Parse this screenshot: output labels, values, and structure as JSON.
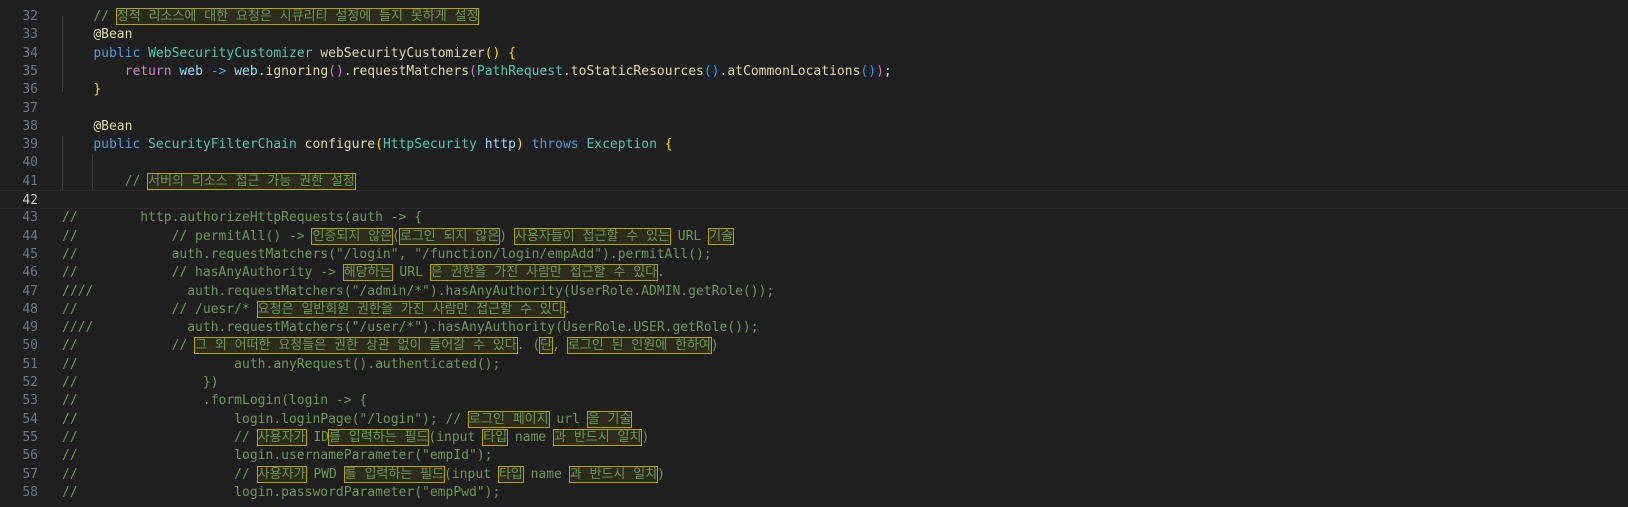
{
  "editor": {
    "current_line": 42,
    "lines": [
      {
        "num": "32",
        "segments": [
          {
            "t": "    "
          },
          {
            "t": "// ",
            "c": "cm"
          },
          {
            "t": "정적 리소스에 대한 요청은 시큐리티 설정에 들지 못하게 설정",
            "c": "cm",
            "h": true
          }
        ]
      },
      {
        "num": "33",
        "segments": [
          {
            "t": "    "
          },
          {
            "t": "@Bean",
            "c": "ann"
          }
        ]
      },
      {
        "num": "34",
        "segments": [
          {
            "t": "    "
          },
          {
            "t": "public ",
            "c": "kw"
          },
          {
            "t": "WebSecurityCustomizer ",
            "c": "ty"
          },
          {
            "t": "webSecurityCustomizer",
            "c": "fn"
          },
          {
            "t": "()",
            "c": "br1"
          },
          {
            "t": " "
          },
          {
            "t": "{",
            "c": "br1"
          }
        ]
      },
      {
        "num": "35",
        "segments": [
          {
            "t": "        "
          },
          {
            "t": "return ",
            "c": "kw2"
          },
          {
            "t": "web ",
            "c": "var"
          },
          {
            "t": "-> ",
            "c": "kw"
          },
          {
            "t": "web",
            "c": "var"
          },
          {
            "t": "."
          },
          {
            "t": "ignoring",
            "c": "fn"
          },
          {
            "t": "()",
            "c": "br2"
          },
          {
            "t": "."
          },
          {
            "t": "requestMatchers",
            "c": "fn"
          },
          {
            "t": "(",
            "c": "br2"
          },
          {
            "t": "PathRequest",
            "c": "ty"
          },
          {
            "t": "."
          },
          {
            "t": "toStaticResources",
            "c": "fn"
          },
          {
            "t": "()",
            "c": "br3"
          },
          {
            "t": "."
          },
          {
            "t": "atCommonLocations",
            "c": "fn"
          },
          {
            "t": "()",
            "c": "br3"
          },
          {
            "t": ")",
            "c": "br2"
          },
          {
            "t": ";"
          }
        ]
      },
      {
        "num": "36",
        "segments": [
          {
            "t": "    "
          },
          {
            "t": "}",
            "c": "br1"
          }
        ]
      },
      {
        "num": "37",
        "segments": []
      },
      {
        "num": "38",
        "segments": [
          {
            "t": "    "
          },
          {
            "t": "@Bean",
            "c": "ann"
          }
        ]
      },
      {
        "num": "39",
        "segments": [
          {
            "t": "    "
          },
          {
            "t": "public ",
            "c": "kw"
          },
          {
            "t": "SecurityFilterChain ",
            "c": "ty"
          },
          {
            "t": "configure",
            "c": "fn"
          },
          {
            "t": "(",
            "c": "br1"
          },
          {
            "t": "HttpSecurity ",
            "c": "ty"
          },
          {
            "t": "http",
            "c": "var"
          },
          {
            "t": ")",
            "c": "br1"
          },
          {
            "t": " "
          },
          {
            "t": "throws ",
            "c": "kw"
          },
          {
            "t": "Exception ",
            "c": "ty"
          },
          {
            "t": "{",
            "c": "br1"
          }
        ]
      },
      {
        "num": "40",
        "segments": []
      },
      {
        "num": "41",
        "segments": [
          {
            "t": "        "
          },
          {
            "t": "// ",
            "c": "cm"
          },
          {
            "t": "서버의 리소스 접근 가능 권한 설정",
            "c": "cm",
            "h": true
          }
        ]
      },
      {
        "num": "42",
        "segments": []
      },
      {
        "num": "43",
        "segments": [
          {
            "t": "//        http.authorizeHttpRequests(auth -> {",
            "c": "cm"
          }
        ]
      },
      {
        "num": "44",
        "segments": [
          {
            "t": "//            // permitAll() -> ",
            "c": "cm"
          },
          {
            "t": "인증되지 않은",
            "c": "cm",
            "h": true
          },
          {
            "t": "(",
            "c": "cm"
          },
          {
            "t": "로그인 되지 않은",
            "c": "cm",
            "h": true
          },
          {
            "t": ") ",
            "c": "cm"
          },
          {
            "t": "사용자들이 접근할 수 있는",
            "c": "cm",
            "h": true
          },
          {
            "t": " URL ",
            "c": "cm"
          },
          {
            "t": "기술",
            "c": "cm",
            "h": true
          }
        ]
      },
      {
        "num": "45",
        "segments": [
          {
            "t": "//            auth.requestMatchers(\"/login\", \"/function/login/empAdd\").permitAll();",
            "c": "cm"
          }
        ]
      },
      {
        "num": "46",
        "segments": [
          {
            "t": "//            // hasAnyAuthority -> ",
            "c": "cm"
          },
          {
            "t": "해당하는",
            "c": "cm",
            "h": true
          },
          {
            "t": " URL ",
            "c": "cm"
          },
          {
            "t": "은 권한을 가진 사람만 접근할 수 있다",
            "c": "cm",
            "h": true
          },
          {
            "t": ".",
            "c": "cm"
          }
        ]
      },
      {
        "num": "47",
        "segments": [
          {
            "t": "////            auth.requestMatchers(\"/admin/*\").hasAnyAuthority(UserRole.ADMIN.getRole());",
            "c": "cm"
          }
        ]
      },
      {
        "num": "48",
        "segments": [
          {
            "t": "//            // /uesr/* ",
            "c": "cm"
          },
          {
            "t": "요청은 일반회원 권한을 가진 사람만 접근할 수 있다",
            "c": "cm",
            "h": true
          },
          {
            "t": ".",
            "c": "cm"
          }
        ]
      },
      {
        "num": "49",
        "segments": [
          {
            "t": "////            auth.requestMatchers(\"/user/*\").hasAnyAuthority(UserRole.USER.getRole());",
            "c": "cm"
          }
        ]
      },
      {
        "num": "50",
        "segments": [
          {
            "t": "//            // ",
            "c": "cm"
          },
          {
            "t": "그 외 어떠한 요청들은 권한 상관 없이 들어갈 수 있다",
            "c": "cm",
            "h": true
          },
          {
            "t": ". (",
            "c": "cm"
          },
          {
            "t": "단",
            "c": "cm",
            "h": true
          },
          {
            "t": ", ",
            "c": "cm"
          },
          {
            "t": "로그인 된 인원에 한하여",
            "c": "cm",
            "h": true
          },
          {
            "t": ")",
            "c": "cm"
          }
        ]
      },
      {
        "num": "51",
        "segments": [
          {
            "t": "//                    auth.anyRequest().authenticated();",
            "c": "cm"
          }
        ]
      },
      {
        "num": "52",
        "segments": [
          {
            "t": "//                })",
            "c": "cm"
          }
        ]
      },
      {
        "num": "53",
        "segments": [
          {
            "t": "//                .formLogin(login -> {",
            "c": "cm"
          }
        ]
      },
      {
        "num": "54",
        "segments": [
          {
            "t": "//                    login.loginPage(\"/login\"); // ",
            "c": "cm"
          },
          {
            "t": "로그인 페이지",
            "c": "cm",
            "h": true
          },
          {
            "t": " url ",
            "c": "cm"
          },
          {
            "t": "을 기술",
            "c": "cm",
            "h": true
          }
        ]
      },
      {
        "num": "55",
        "segments": [
          {
            "t": "//                    // ",
            "c": "cm"
          },
          {
            "t": "사용자가",
            "c": "cm",
            "h": true
          },
          {
            "t": " ID",
            "c": "cm"
          },
          {
            "t": "를 입력하는 필드",
            "c": "cm",
            "h": true
          },
          {
            "t": "(input ",
            "c": "cm"
          },
          {
            "t": "타입",
            "c": "cm",
            "h": true
          },
          {
            "t": " name ",
            "c": "cm"
          },
          {
            "t": "과 반드시 일치",
            "c": "cm",
            "h": true
          },
          {
            "t": ")",
            "c": "cm"
          }
        ]
      },
      {
        "num": "56",
        "segments": [
          {
            "t": "//                    login.usernameParameter(\"empId\");",
            "c": "cm"
          }
        ]
      },
      {
        "num": "57",
        "segments": [
          {
            "t": "//                    // ",
            "c": "cm"
          },
          {
            "t": "사용자가",
            "c": "cm",
            "h": true
          },
          {
            "t": " PWD ",
            "c": "cm"
          },
          {
            "t": "를 입력하는 필드",
            "c": "cm",
            "h": true
          },
          {
            "t": "(input ",
            "c": "cm"
          },
          {
            "t": "타입",
            "c": "cm",
            "h": true
          },
          {
            "t": " name ",
            "c": "cm"
          },
          {
            "t": "과 반드시 일치",
            "c": "cm",
            "h": true
          },
          {
            "t": ")",
            "c": "cm"
          }
        ]
      },
      {
        "num": "58",
        "segments": [
          {
            "t": "//                    login.passwordParameter(\"empPwd\");",
            "c": "cm"
          }
        ]
      }
    ]
  }
}
